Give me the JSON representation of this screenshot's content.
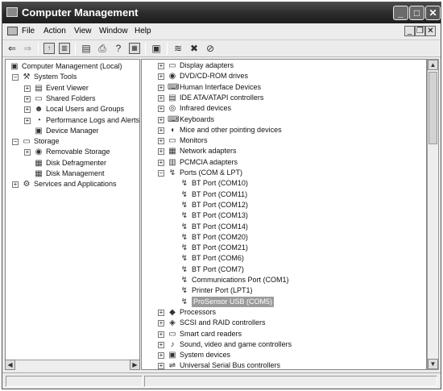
{
  "window": {
    "title": "Computer Management"
  },
  "menubar": {
    "items": [
      "File",
      "Action",
      "View",
      "Window",
      "Help"
    ]
  },
  "left_tree": {
    "items": [
      {
        "label": "Computer Management (Local)",
        "level": 0,
        "icon": "computer-icon",
        "expander": ""
      },
      {
        "label": "System Tools",
        "level": 1,
        "icon": "tools-icon",
        "expander": "-"
      },
      {
        "label": "Event Viewer",
        "level": 2,
        "icon": "event-viewer-icon",
        "expander": "+"
      },
      {
        "label": "Shared Folders",
        "level": 2,
        "icon": "folder-icon",
        "expander": "+"
      },
      {
        "label": "Local Users and Groups",
        "level": 2,
        "icon": "users-icon",
        "expander": "+"
      },
      {
        "label": "Performance Logs and Alerts",
        "level": 2,
        "icon": "performance-icon",
        "expander": "+"
      },
      {
        "label": "Device Manager",
        "level": 2,
        "icon": "device-manager-icon",
        "expander": ""
      },
      {
        "label": "Storage",
        "level": 1,
        "icon": "storage-icon",
        "expander": "-"
      },
      {
        "label": "Removable Storage",
        "level": 2,
        "icon": "removable-storage-icon",
        "expander": "+"
      },
      {
        "label": "Disk Defragmenter",
        "level": 2,
        "icon": "defrag-icon",
        "expander": ""
      },
      {
        "label": "Disk Management",
        "level": 2,
        "icon": "disk-icon",
        "expander": ""
      },
      {
        "label": "Services and Applications",
        "level": 1,
        "icon": "services-icon",
        "expander": "+"
      }
    ]
  },
  "right_tree": {
    "items": [
      {
        "label": "Display adapters",
        "level": 0,
        "icon": "display-icon",
        "expander": "+"
      },
      {
        "label": "DVD/CD-ROM drives",
        "level": 0,
        "icon": "cdrom-icon",
        "expander": "+"
      },
      {
        "label": "Human Interface Devices",
        "level": 0,
        "icon": "hid-icon",
        "expander": "+"
      },
      {
        "label": "IDE ATA/ATAPI controllers",
        "level": 0,
        "icon": "ide-icon",
        "expander": "+"
      },
      {
        "label": "Infrared devices",
        "level": 0,
        "icon": "infrared-icon",
        "expander": "+"
      },
      {
        "label": "Keyboards",
        "level": 0,
        "icon": "keyboard-icon",
        "expander": "+"
      },
      {
        "label": "Mice and other pointing devices",
        "level": 0,
        "icon": "mouse-icon",
        "expander": "+"
      },
      {
        "label": "Monitors",
        "level": 0,
        "icon": "monitor-icon",
        "expander": "+"
      },
      {
        "label": "Network adapters",
        "level": 0,
        "icon": "network-icon",
        "expander": "+"
      },
      {
        "label": "PCMCIA adapters",
        "level": 0,
        "icon": "pcmcia-icon",
        "expander": "+"
      },
      {
        "label": "Ports (COM & LPT)",
        "level": 0,
        "icon": "port-icon",
        "expander": "-"
      },
      {
        "label": "BT Port (COM10)",
        "level": 1,
        "icon": "port-icon",
        "expander": ""
      },
      {
        "label": "BT Port (COM11)",
        "level": 1,
        "icon": "port-icon",
        "expander": ""
      },
      {
        "label": "BT Port (COM12)",
        "level": 1,
        "icon": "port-icon",
        "expander": ""
      },
      {
        "label": "BT Port (COM13)",
        "level": 1,
        "icon": "port-icon",
        "expander": ""
      },
      {
        "label": "BT Port (COM14)",
        "level": 1,
        "icon": "port-icon",
        "expander": ""
      },
      {
        "label": "BT Port (COM20)",
        "level": 1,
        "icon": "port-icon",
        "expander": ""
      },
      {
        "label": "BT Port (COM21)",
        "level": 1,
        "icon": "port-icon",
        "expander": ""
      },
      {
        "label": "BT Port (COM6)",
        "level": 1,
        "icon": "port-icon",
        "expander": ""
      },
      {
        "label": "BT Port (COM7)",
        "level": 1,
        "icon": "port-icon",
        "expander": ""
      },
      {
        "label": "Communications Port (COM1)",
        "level": 1,
        "icon": "port-icon",
        "expander": ""
      },
      {
        "label": "Printer Port (LPT1)",
        "level": 1,
        "icon": "port-icon",
        "expander": ""
      },
      {
        "label": "ProSensor USB (COM5)",
        "level": 1,
        "icon": "port-icon",
        "expander": "",
        "selected": true
      },
      {
        "label": "Processors",
        "level": 0,
        "icon": "processor-icon",
        "expander": "+"
      },
      {
        "label": "SCSI and RAID controllers",
        "level": 0,
        "icon": "scsi-icon",
        "expander": "+"
      },
      {
        "label": "Smart card readers",
        "level": 0,
        "icon": "smartcard-icon",
        "expander": "+"
      },
      {
        "label": "Sound, video and game controllers",
        "level": 0,
        "icon": "sound-icon",
        "expander": "+"
      },
      {
        "label": "System devices",
        "level": 0,
        "icon": "system-icon",
        "expander": "+"
      },
      {
        "label": "Universal Serial Bus controllers",
        "level": 0,
        "icon": "usb-icon",
        "expander": "+"
      }
    ]
  }
}
